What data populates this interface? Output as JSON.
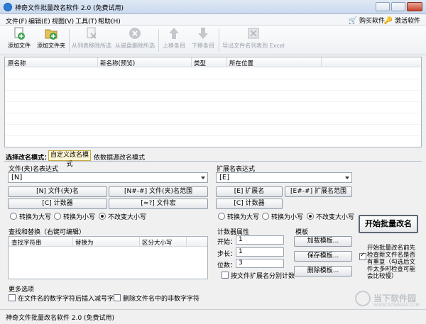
{
  "window": {
    "title": "神奇文件批量改名软件 2.0 (免费试用)"
  },
  "menu": {
    "items": [
      "文件(F)",
      "编辑(E)",
      "视图(V)",
      "工具(T)",
      "帮助(H)"
    ],
    "buy": "购买软件",
    "activate": "激活软件"
  },
  "toolbar": {
    "add_file": "添加文件",
    "add_folder": "添加文件夹",
    "remove_from_list": "从列表移除所选",
    "delete_from_disk": "从磁盘删除所选",
    "move_up": "上移条目",
    "move_down": "下移条目",
    "export_excel": "导出文件名列表到 Excel"
  },
  "filelist": {
    "columns": [
      "原名称",
      "新名称(预览)",
      "类型",
      "所在位置"
    ]
  },
  "mode": {
    "label": "选择改名模式：",
    "tab_custom": "自定义改名模式",
    "tab_data": "依数据源改名模式"
  },
  "filename_expr": {
    "title": "文件(夹)名表达式",
    "value": "[N]",
    "btn_name": "[N] 文件(夹)名",
    "btn_range": "[N#-#] 文件(夹)名范围",
    "btn_counter": "[C] 计数器",
    "btn_macro": "[=?] 文件宏",
    "radio_upper": "转换为大写",
    "radio_lower": "转换为小写",
    "radio_keep": "不改变大小写"
  },
  "ext_expr": {
    "title": "扩展名表达式",
    "value": "[E]",
    "btn_ext": "[E] 扩展名",
    "btn_ext_range": "[E#-#] 扩展名范围",
    "btn_counter": "[C] 计数器",
    "radio_upper": "转换为大写",
    "radio_lower": "转换为小写",
    "radio_keep": "不改变大小写"
  },
  "replace": {
    "title": "查找和替换（右键可编辑）",
    "columns": [
      "查找字符串",
      "替换为",
      "区分大小写"
    ]
  },
  "counter": {
    "title": "计数器属性",
    "start_label": "开始：",
    "start_value": "1",
    "step_label": "步长：",
    "step_value": "1",
    "digits_label": "位数：",
    "digits_value": "3",
    "by_ext_label": "按文件扩展名分别计数"
  },
  "template": {
    "title": "模板",
    "load": "加载模板...",
    "save": "保存模板...",
    "delete": "删除模板..."
  },
  "start_button": "开始批量改名",
  "preview_check_label": "开始批量改名前先检查新文件名是否有重复（勾选后文件太多时检查可能会比较慢）",
  "more": {
    "title": "更多选项",
    "opt1": "在文件名的数字字符后插入减号字符",
    "opt2": "删除文件名中的非数字字符"
  },
  "status": "神奇文件批量改名软件 2.0 (免费试用)",
  "watermark": {
    "title": "当下软件园",
    "sub": "WWW.DOWNXIA.COM"
  }
}
